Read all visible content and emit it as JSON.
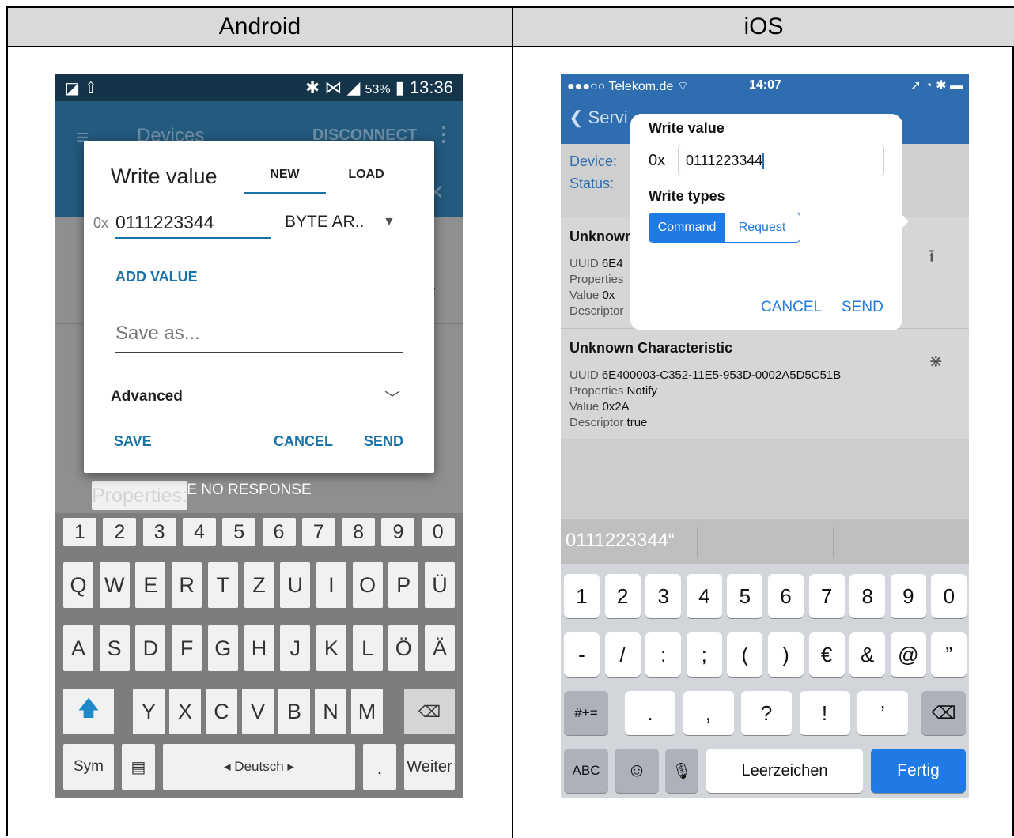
{
  "table": {
    "left_header": "Android",
    "right_header": "iOS"
  },
  "android": {
    "status": {
      "left_icons": "◪ ⇧",
      "right_icons": "✱ ⋈ ◢",
      "battery": "53%",
      "time": "13:36"
    },
    "appbar": {
      "menu_icon": "≡",
      "title": "Devices",
      "disconnect": "DISCONNECT",
      "overflow": "⋮",
      "close": "✕"
    },
    "background_properties": {
      "key": "Properties: ",
      "value": "WRITE, WRITE NO RESPONSE"
    },
    "dialog": {
      "title": "Write value",
      "tab_new": "NEW",
      "tab_load": "LOAD",
      "prefix": "0x",
      "value": "0111223344",
      "type": "BYTE AR..",
      "add_value": "ADD VALUE",
      "save_as_placeholder": "Save as...",
      "advanced": "Advanced",
      "save": "SAVE",
      "cancel": "CANCEL",
      "send": "SEND"
    },
    "keyboard": {
      "row_digits": [
        "1",
        "2",
        "3",
        "4",
        "5",
        "6",
        "7",
        "8",
        "9",
        "0"
      ],
      "row_q": [
        "Q",
        "W",
        "E",
        "R",
        "T",
        "Z",
        "U",
        "I",
        "O",
        "P",
        "Ü"
      ],
      "row_a": [
        "A",
        "S",
        "D",
        "F",
        "G",
        "H",
        "J",
        "K",
        "L",
        "Ö",
        "Ä"
      ],
      "row_y": [
        "Y",
        "X",
        "C",
        "V",
        "B",
        "N",
        "M"
      ],
      "shift": "🡅",
      "backspace": "⌫",
      "sym": "Sym",
      "clip": "▤",
      "language": "◂ Deutsch ▸",
      "period": ".",
      "next": "Weiter"
    }
  },
  "ios": {
    "status": {
      "carrier": "●●●○○ Telekom.de ⌔",
      "time": "14:07",
      "right_icons": "➚ ◔ ✱ ▬"
    },
    "nav": {
      "back": "❮ Servi"
    },
    "info": {
      "device_label": "Device:",
      "status_label": "Status:"
    },
    "characteristics": [
      {
        "name": "Unknown",
        "uuid_k": "UUID",
        "uuid_v": "6E4",
        "props_k": "Properties",
        "props_v": "",
        "value_k": "Value",
        "value_v": "0x",
        "desc_k": "Descriptor",
        "desc_v": "",
        "icon": "⭱"
      },
      {
        "name": "Unknown Characteristic",
        "uuid_k": "UUID",
        "uuid_v": "6E400003-C352-11E5-953D-0002A5D5C51B",
        "props_k": "Properties",
        "props_v": "Notify",
        "value_k": "Value",
        "value_v": "0x2A",
        "desc_k": "Descriptor",
        "desc_v": "true",
        "icon": "⋇"
      }
    ],
    "popover": {
      "title": "Write value",
      "prefix": "0x",
      "value": "0111223344",
      "write_types": "Write types",
      "command": "Command",
      "request": "Request",
      "cancel": "CANCEL",
      "send": "SEND"
    },
    "suggestion": "0111223344“",
    "keyboard": {
      "row1": [
        "1",
        "2",
        "3",
        "4",
        "5",
        "6",
        "7",
        "8",
        "9",
        "0"
      ],
      "row2": [
        "-",
        "/",
        ":",
        ";",
        "(",
        ")",
        "€",
        "&",
        "@",
        "”"
      ],
      "row3": [
        ".",
        ",",
        "?",
        "!",
        "’"
      ],
      "more": "#+=",
      "backspace": "⌫",
      "abc": "ABC",
      "emoji": "☺",
      "mic": "🎙",
      "space": "Leerzeichen",
      "done": "Fertig"
    }
  }
}
